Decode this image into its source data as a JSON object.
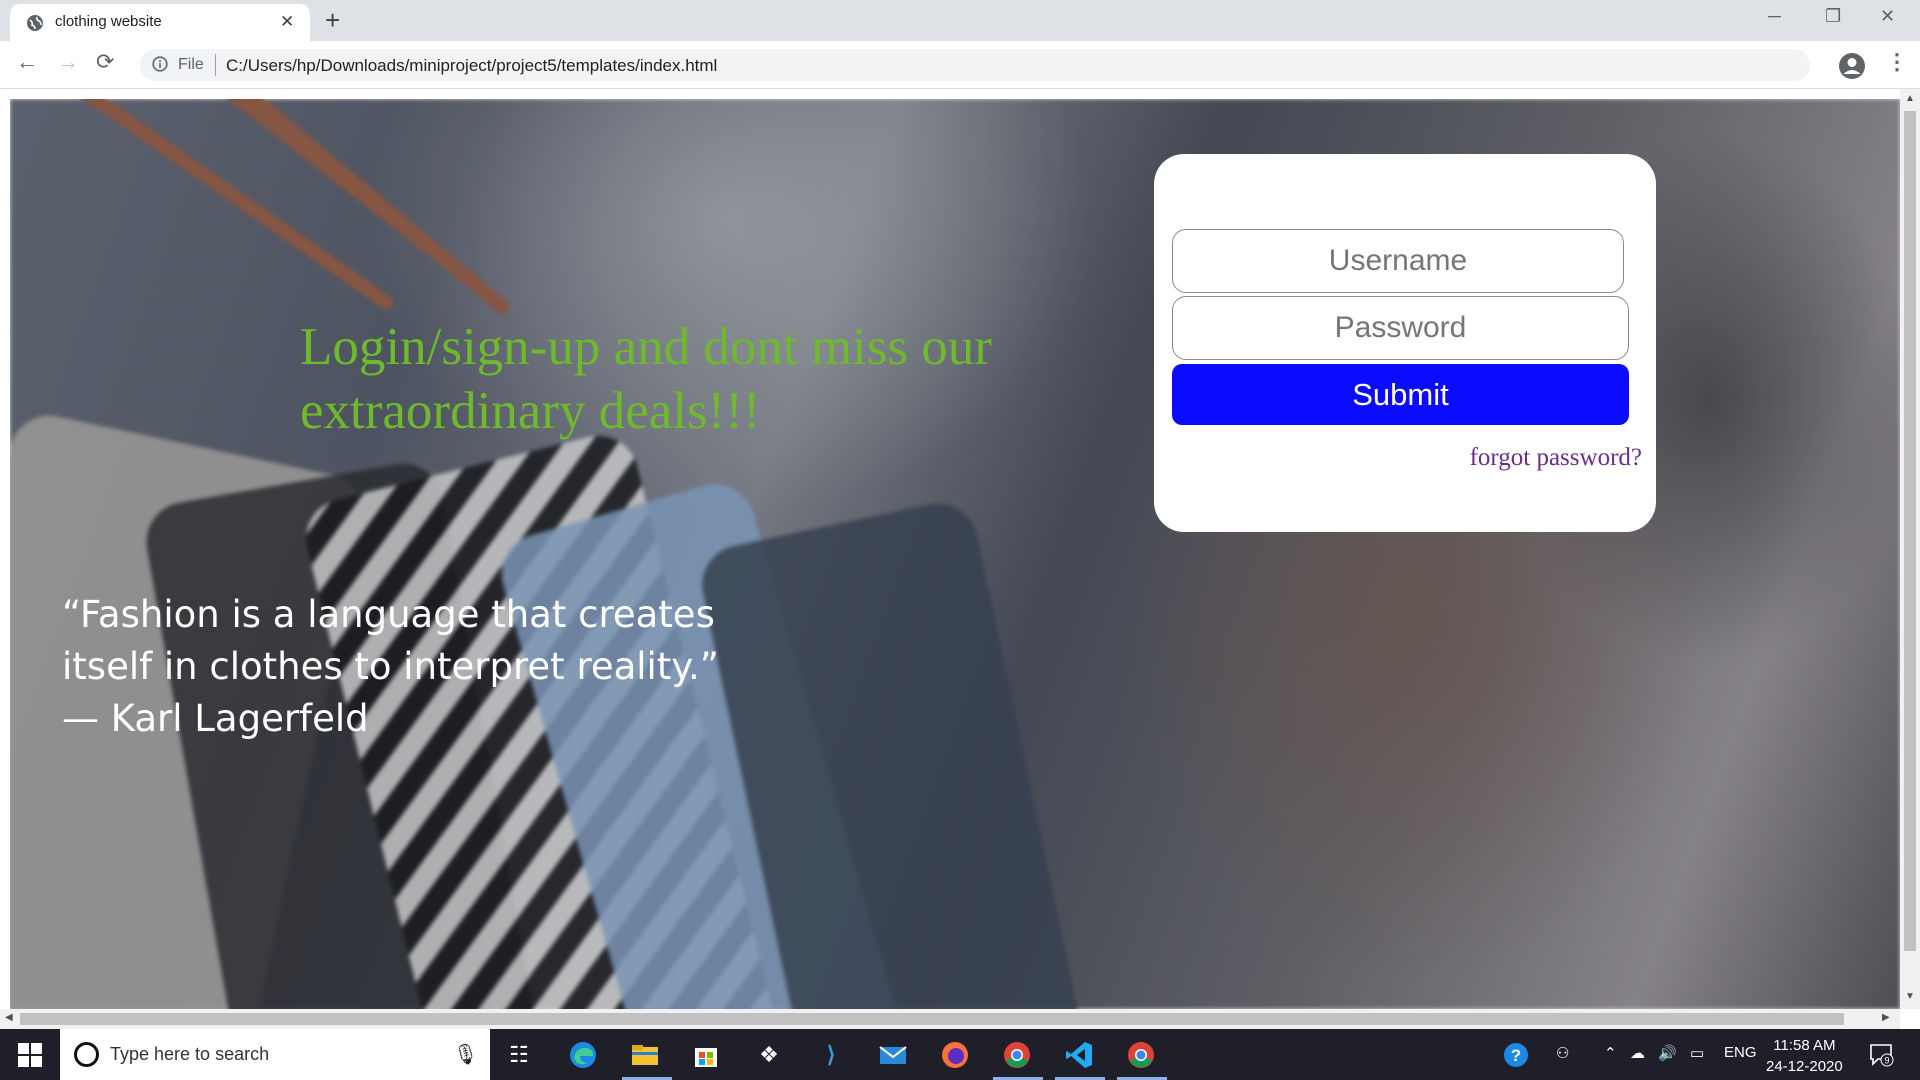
{
  "browser": {
    "tab_title": "clothing website",
    "tab_close": "✕",
    "new_tab": "+",
    "window_controls": {
      "minimize": "─",
      "maximize": "❐",
      "close": "✕"
    },
    "nav": {
      "back": "←",
      "forward": "→",
      "reload": "⟳"
    },
    "address": {
      "scheme_label": "File",
      "url": "C:/Users/hp/Downloads/miniproject/project5/templates/index.html"
    },
    "bookmark_icon": "☆",
    "menu_icon": "⋮"
  },
  "page": {
    "headline": "Login/sign-up and dont miss our extraordinary deals!!!",
    "quote_line1": "“Fashion is a language that creates",
    "quote_line2": "itself in clothes to interpret reality.”",
    "quote_author": "— Karl Lagerfeld",
    "login": {
      "username_placeholder": "Username",
      "password_placeholder": "Password",
      "submit_label": "Submit",
      "forgot_label": "forgot password?"
    },
    "colors": {
      "headline": "#6fb92d",
      "submit_bg": "#0b0bff",
      "forgot_link": "#6b2c8f"
    }
  },
  "taskbar": {
    "search_placeholder": "Type here to search",
    "tray": {
      "language": "ENG"
    },
    "clock": {
      "time": "11:58 AM",
      "date": "24-12-2020"
    },
    "notification_count": "9"
  }
}
